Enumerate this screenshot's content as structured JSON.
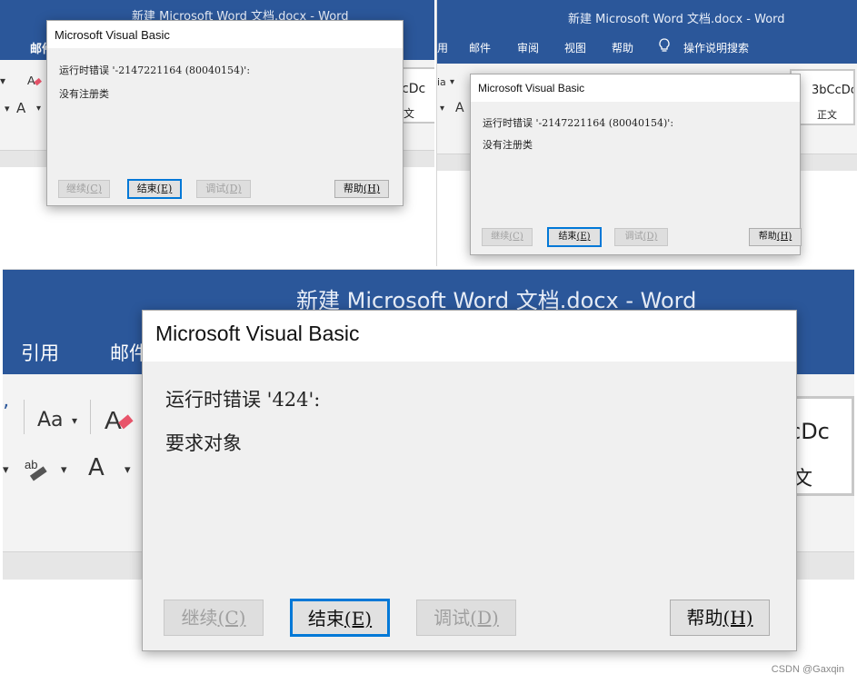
{
  "panels": {
    "a": {
      "title": "新建 Microsoft Word 文档.docx  -  Word",
      "tab_partial": "邮件",
      "ribbon": {
        "aa": "A",
        "a_font": "A",
        "style_cut": "cDc",
        "style_sub": "文"
      },
      "dialog": {
        "title": "Microsoft Visual Basic",
        "error": "运行时错误 '-2147221164 (80040154)':",
        "message": "没有注册类",
        "continue": {
          "text": "继续",
          "key": "(C)"
        },
        "end": {
          "text": "结束",
          "key": "(E)"
        },
        "debug": {
          "text": "调试",
          "key": "(D)"
        },
        "help": {
          "text": "帮助",
          "key": "(H)"
        }
      }
    },
    "b": {
      "title": "新建 Microsoft Word 文档.docx  -  Word",
      "tabs": [
        "用",
        "邮件",
        "审阅",
        "视图",
        "帮助",
        "操作说明搜索"
      ],
      "ribbon": {
        "aa": "ia",
        "a_font": "A",
        "style_cut": "3bCcDc",
        "style_sub": "正文"
      },
      "dialog": {
        "title": "Microsoft Visual Basic",
        "error": "运行时错误 '-2147221164 (80040154)':",
        "message": "没有注册类",
        "continue": {
          "text": "继续",
          "key": "(C)"
        },
        "end": {
          "text": "结束",
          "key": "(E)"
        },
        "debug": {
          "text": "调试",
          "key": "(D)"
        },
        "help": {
          "text": "帮助",
          "key": "(H)"
        }
      }
    },
    "c": {
      "title": "新建 Microsoft Word 文档.docx  -  Word",
      "tabs": [
        "引用",
        "邮件"
      ],
      "ribbon": {
        "aa": "Aa",
        "a_font": "A",
        "style_cut": "cDc",
        "style_sub": "文"
      },
      "dialog": {
        "title": "Microsoft Visual Basic",
        "error": "运行时错误 '424':",
        "message": "要求对象",
        "continue": {
          "text": "继续",
          "key": "(C)"
        },
        "end": {
          "text": "结束",
          "key": "(E)"
        },
        "debug": {
          "text": "调试",
          "key": "(D)"
        },
        "help": {
          "text": "帮助",
          "key": "(H)"
        }
      }
    }
  },
  "watermark": "CSDN @Gaxqin",
  "colors": {
    "word_blue": "#2b579a",
    "dialog_bg": "#f0f0f0",
    "focus_border": "#0078d7"
  },
  "icons": [
    "eraser-icon",
    "lightbulb-icon",
    "dropdown-arrow-icon"
  ]
}
